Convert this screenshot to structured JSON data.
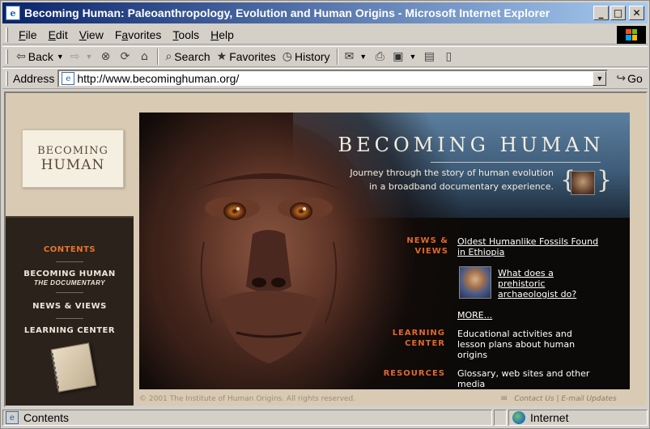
{
  "window": {
    "title": "Becoming Human: Paleoanthropology, Evolution and Human Origins - Microsoft Internet Explorer",
    "controls": {
      "minimize": "_",
      "maximize": "□",
      "close": "✕"
    }
  },
  "menu": {
    "items": [
      {
        "label": "File",
        "key": "F",
        "rest": "ile"
      },
      {
        "label": "Edit",
        "key": "E",
        "rest": "dit"
      },
      {
        "label": "View",
        "key": "V",
        "rest": "iew"
      },
      {
        "label": "Favorites",
        "key": "a",
        "pre": "F",
        "rest": "vorites"
      },
      {
        "label": "Tools",
        "key": "T",
        "rest": "ools"
      },
      {
        "label": "Help",
        "key": "H",
        "rest": "elp"
      }
    ]
  },
  "toolbar": {
    "back_label": "Back",
    "search_label": "Search",
    "favorites_label": "Favorites",
    "history_label": "History",
    "icons": {
      "back": "arrow-left-icon",
      "forward": "arrow-right-icon",
      "stop": "stop-icon",
      "refresh": "refresh-icon",
      "home": "home-icon",
      "search": "search-icon",
      "favorites": "favorites-icon",
      "history": "history-icon",
      "mail": "mail-icon",
      "print": "print-icon",
      "edit": "edit-icon",
      "discuss": "discuss-icon",
      "messenger": "messenger-icon"
    }
  },
  "address": {
    "label": "Address",
    "url": "http://www.becominghuman.org/",
    "go_label": "Go"
  },
  "site": {
    "logo_line1": "BECOMING",
    "logo_line2": "HUMAN",
    "nav": {
      "contents": "CONTENTS",
      "documentary": "BECOMING HUMAN",
      "documentary_sub": "THE DOCUMENTARY",
      "news": "NEWS & VIEWS",
      "learning": "LEARNING CENTER"
    },
    "hero": {
      "title": "BECOMING HUMAN",
      "tagline1": "Journey through the story of human evolution",
      "tagline2": "in a broadband documentary experience."
    },
    "sections": {
      "news_label_1": "NEWS &",
      "news_label_2": "VIEWS",
      "news_story1_line1": "Oldest Humanlike Fossils Found",
      "news_story1_line2": "in Ethiopia",
      "news_story2_line1": "What does a",
      "news_story2_line2": "prehistoric",
      "news_story2_line3": "archaeologist do?",
      "more": "MORE...",
      "learning_label_1": "LEARNING",
      "learning_label_2": "CENTER",
      "learning_text_1": "Educational activities and",
      "learning_text_2": "lesson plans about human",
      "learning_text_3": "origins",
      "resources_label": "RESOURCES",
      "resources_text_1": "Glossary, web sites and other",
      "resources_text_2": "media"
    },
    "footer": {
      "copyright": "© 2001 The Institute of Human Origins. All rights reserved.",
      "contact": "Contact Us",
      "separator": "|",
      "updates": "E-mail Updates"
    }
  },
  "status": {
    "text": "Contents",
    "zone": "Internet"
  }
}
